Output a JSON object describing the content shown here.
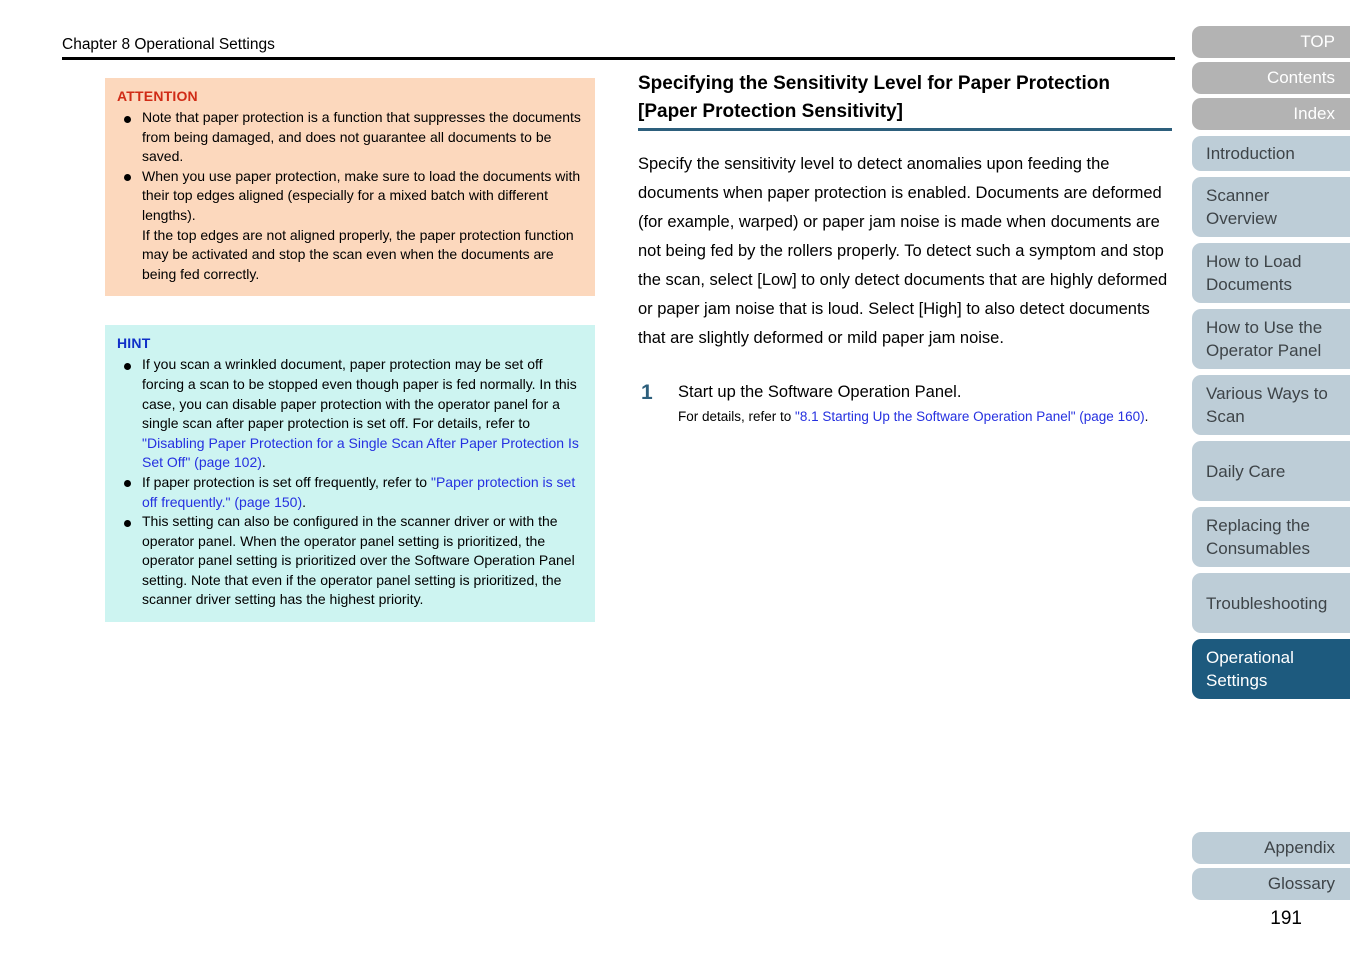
{
  "header": {
    "chapter": "Chapter 8 Operational Settings"
  },
  "attention": {
    "label": "ATTENTION",
    "items": [
      {
        "text": "Note that paper protection is a function that suppresses the documents from being damaged, and does not guarantee all documents to be saved."
      },
      {
        "text": "When you use paper protection, make sure to load the documents with their top edges aligned (especially for a mixed batch with different lengths).",
        "sub": "If the top edges are not aligned properly, the paper protection function may be activated and stop the scan even when the documents are being fed correctly."
      }
    ]
  },
  "hint": {
    "label": "HINT",
    "items": [
      {
        "pre": "If you scan a wrinkled document, paper protection may be set off forcing a scan to be stopped even though paper is fed normally. In this case, you can disable paper protection with the operator panel for a single scan after paper protection is set off. For details, refer to ",
        "link": "\"Disabling Paper Protection for a Single Scan After Paper Protection Is Set Off\" (page 102)",
        "post": "."
      },
      {
        "pre": "If paper protection is set off frequently, refer to ",
        "link": "\"Paper protection is set off frequently.\" (page 150)",
        "post": "."
      },
      {
        "pre": "This setting can also be configured in the scanner driver or with the operator panel. When the operator panel setting is prioritized, the operator panel setting is prioritized over the Software Operation Panel setting. Note that even if the operator panel setting is prioritized, the scanner driver setting has the highest priority.",
        "link": "",
        "post": ""
      }
    ]
  },
  "main": {
    "heading_line1": "Specifying the Sensitivity Level for Paper Protection",
    "heading_line2": "[Paper Protection Sensitivity]",
    "body": "Specify the sensitivity level to detect anomalies upon feeding the documents when paper protection is enabled. Documents are deformed (for example, warped) or paper jam noise is made when documents are not being fed by the rollers properly. To detect such a symptom and stop the scan, select [Low] to only detect documents that are highly deformed or paper jam noise that is loud. Select [High] to also detect documents that are slightly deformed or mild paper jam noise.",
    "steps": [
      {
        "number": "1",
        "title": "Start up the Software Operation Panel.",
        "detail_pre": "For details, refer to ",
        "detail_link": "\"8.1 Starting Up the Software Operation Panel\" (page 160)",
        "detail_post": "."
      }
    ]
  },
  "side_nav": {
    "top_items": [
      {
        "label": "TOP"
      },
      {
        "label": "Contents"
      },
      {
        "label": "Index"
      }
    ],
    "section_items": [
      {
        "label": "Introduction",
        "lines": 1,
        "active": false
      },
      {
        "label": "Scanner Overview",
        "lines": 2,
        "active": false
      },
      {
        "label": "How to Load Documents",
        "lines": 2,
        "active": false
      },
      {
        "label": "How to Use the Operator Panel",
        "lines": 2,
        "active": false
      },
      {
        "label": "Various Ways to Scan",
        "lines": 2,
        "active": false
      },
      {
        "label": "Daily Care",
        "lines": 2,
        "active": false
      },
      {
        "label": "Replacing the Consumables",
        "lines": 2,
        "active": false
      },
      {
        "label": "Troubleshooting",
        "lines": 2,
        "active": false
      },
      {
        "label": "Operational Settings",
        "lines": 2,
        "active": true
      }
    ],
    "bottom_items": [
      {
        "label": "Appendix"
      },
      {
        "label": "Glossary"
      }
    ]
  },
  "page_number": "191",
  "colors": {
    "attention_bg": "#fcd8bd",
    "attention_label": "#d02b16",
    "hint_bg": "#cdf4f1",
    "hint_label": "#1030c8",
    "link": "#2530e0",
    "nav_plain_bg": "#b3b3b3",
    "nav_section_bg": "#bdcdd7",
    "nav_active_bg": "#1d5a7e",
    "heading_rule": "#2d5f7c",
    "step_number": "#2d5f7c"
  }
}
